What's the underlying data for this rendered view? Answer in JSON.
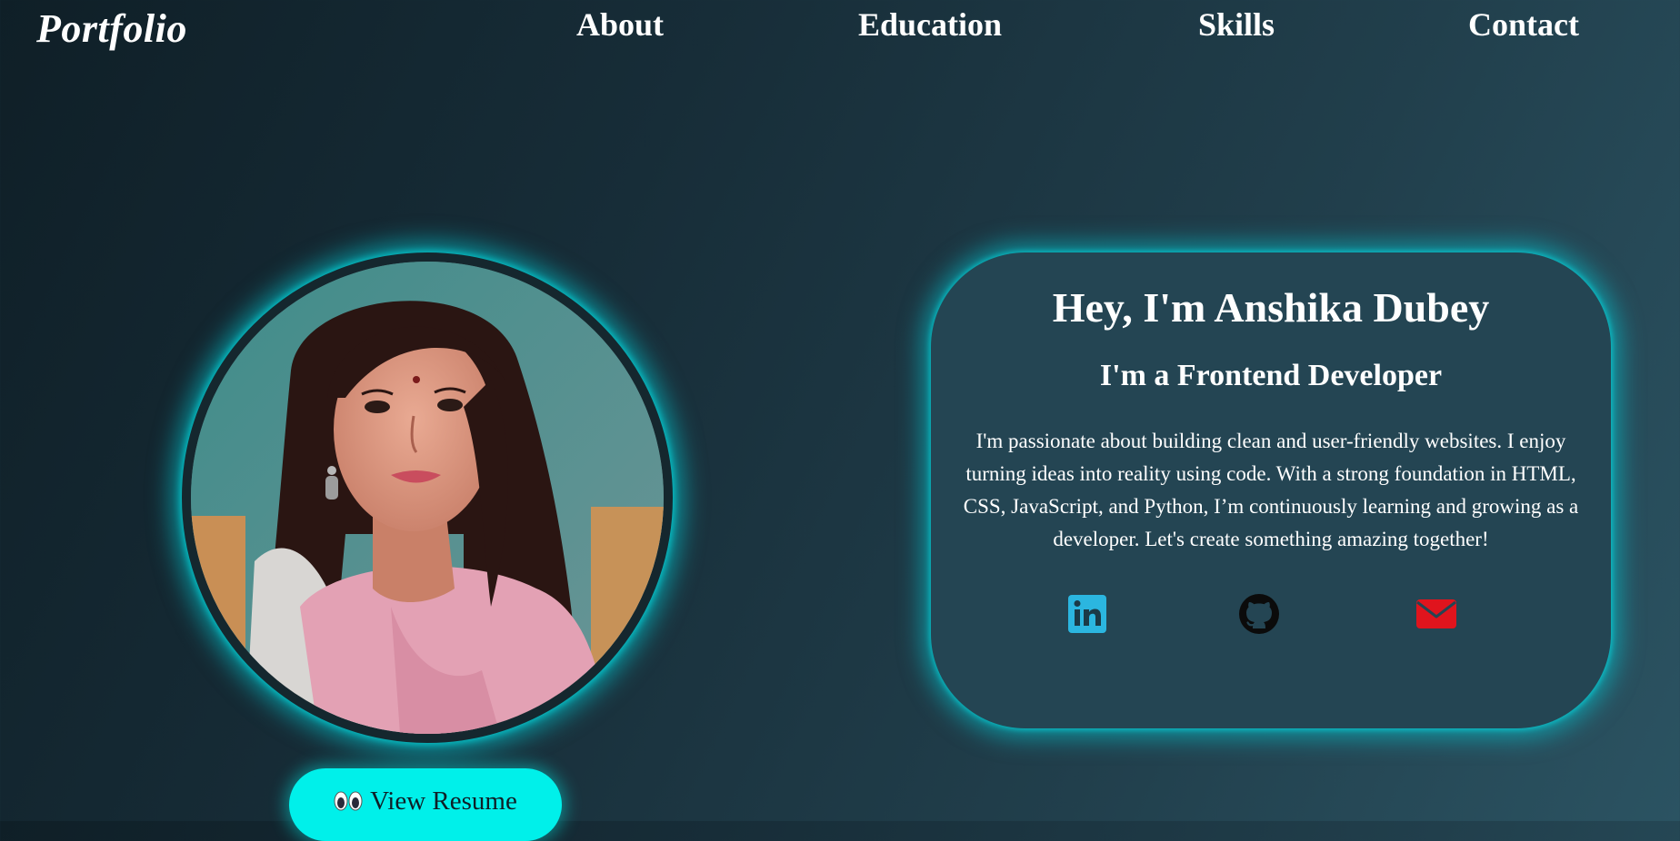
{
  "nav": {
    "logo": "Portfolio",
    "links": [
      "About",
      "Education",
      "Skills",
      "Contact"
    ]
  },
  "hero": {
    "photo_alt": "Profile photo of Anshika Dubey",
    "resume_button": {
      "icon": "eyes-emoji",
      "label": "View Resume"
    }
  },
  "card": {
    "title": "Hey, I'm Anshika Dubey",
    "subtitle": "I'm a Frontend Developer",
    "description": "I'm passionate about building clean and user-friendly websites. I enjoy turning ideas into reality using code. With a strong foundation in HTML, CSS, JavaScript, and Python, I’m continuously learning and growing as a developer. Let's create something amazing together!",
    "socials": [
      {
        "name": "linkedin-icon",
        "color": "#2bb6e0"
      },
      {
        "name": "github-icon",
        "color": "#0b0b0b"
      },
      {
        "name": "mail-icon",
        "color": "#e0141d"
      }
    ]
  },
  "colors": {
    "accent": "#00f0ea",
    "card_bg": "#244553",
    "background_dark": "#0f1f27",
    "background_light": "#2b5362"
  }
}
